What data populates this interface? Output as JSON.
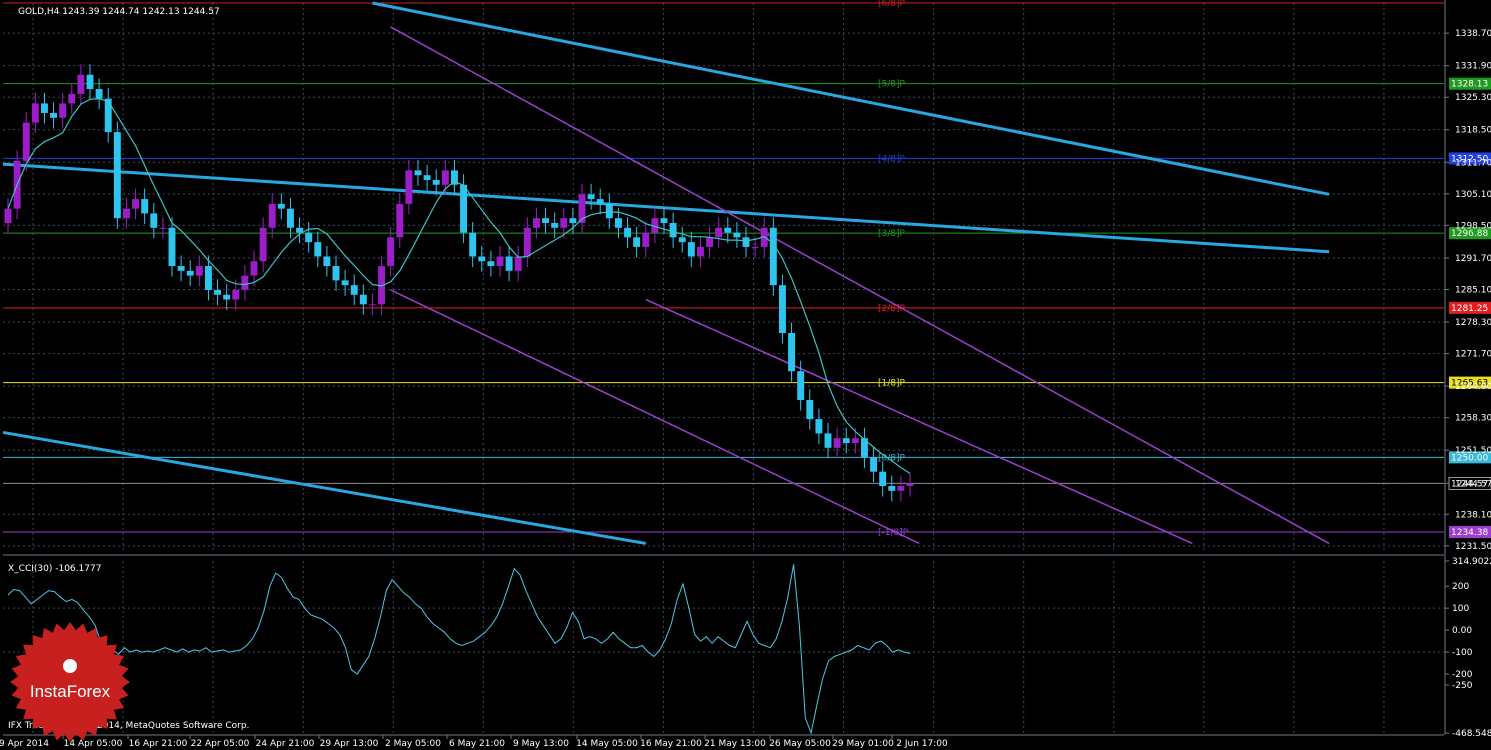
{
  "window": {
    "symbol_header": "GOLD,H4  1243.39 1244.74 1242.13 1244.57",
    "indicator_header": "X_CCI(30) -106.1777",
    "copyright": "IFX Trader, © 2001-2014, MetaQuotes Software Corp.",
    "logo_text": "InstaForex"
  },
  "colors": {
    "background": "#000000",
    "grid": "#3a4a5a",
    "bull_candle": "#9b1ec8",
    "bear_candle": "#2ec4f0",
    "moving_average": "#3cc4c4",
    "channel_blue": "#29a8e0",
    "channel_purple": "#9b3fd0",
    "cci_line": "#4fc8e8",
    "logo_red": "#c8201e"
  },
  "chart_data": [
    {
      "type": "candlestick",
      "symbol": "GOLD",
      "timeframe": "H4",
      "ohlc_last": {
        "open": 1243.39,
        "high": 1244.74,
        "low": 1242.13,
        "close": 1244.57
      },
      "y_ticks": [
        "1338.70",
        "1331.90",
        "1325.30",
        "1318.50",
        "1311.70",
        "1305.10",
        "1298.50",
        "1291.70",
        "1285.10",
        "1278.30",
        "1271.70",
        "1264.90",
        "1258.30",
        "1251.50",
        "1244.57",
        "1238.10",
        "1231.50"
      ],
      "ylim": [
        1230,
        1345
      ],
      "x_ticks": [
        "9 Apr 2014",
        "14 Apr 05:00",
        "16 Apr 21:00",
        "22 Apr 05:00",
        "24 Apr 21:00",
        "29 Apr 13:00",
        "2 May 05:00",
        "6 May 21:00",
        "9 May 13:00",
        "14 May 05:00",
        "16 May 21:00",
        "21 May 13:00",
        "26 May 05:00",
        "29 May 01:00",
        "2 Jun 17:00"
      ],
      "close_path": [
        1302,
        1312,
        1320,
        1324,
        1322,
        1321,
        1324,
        1326,
        1330,
        1327,
        1325,
        1318,
        1300,
        1302,
        1304,
        1301,
        1298,
        1298,
        1290,
        1289,
        1288,
        1290,
        1285,
        1284,
        1283,
        1285,
        1288,
        1291,
        1298,
        1303,
        1302,
        1298,
        1297,
        1295,
        1292,
        1290,
        1287,
        1286,
        1284,
        1282,
        1282,
        1290,
        1296,
        1303,
        1310,
        1309,
        1308,
        1307,
        1310,
        1307,
        1297,
        1292,
        1291,
        1290,
        1292,
        1289,
        1292,
        1298,
        1300,
        1299,
        1298,
        1300,
        1299,
        1305,
        1304,
        1303,
        1300,
        1298,
        1296,
        1294,
        1297,
        1300,
        1299,
        1296,
        1295,
        1292,
        1294,
        1296,
        1298,
        1297,
        1296,
        1294,
        1294,
        1298,
        1286,
        1276,
        1268,
        1262,
        1258,
        1255,
        1252,
        1254,
        1253,
        1254,
        1250,
        1247,
        1244,
        1243,
        1244,
        1244.57
      ],
      "levels": [
        {
          "label": "[6/8]P",
          "value": 1345.0,
          "color": "#cc2020",
          "tag": ""
        },
        {
          "label": "[5/8]P",
          "value": 1328.13,
          "color": "#1e9a1e",
          "tag": "1328.13"
        },
        {
          "label": "[4/8]P",
          "value": 1312.5,
          "color": "#2040e0",
          "tag": "1312.50"
        },
        {
          "label": "[3/8]P",
          "value": 1296.88,
          "color": "#1e9a1e",
          "tag": "1296.88"
        },
        {
          "label": "[2/8]P",
          "value": 1281.25,
          "color": "#e02020",
          "tag": "1281.25"
        },
        {
          "label": "[1/8]P",
          "value": 1265.63,
          "color": "#e8e020",
          "tag": "1265.63"
        },
        {
          "label": "[0/8]P",
          "value": 1250.0,
          "color": "#3ab8d8",
          "tag": "1250.00"
        },
        {
          "label": "[-1/8]P",
          "value": 1234.38,
          "color": "#9b3fd0",
          "tag": "1234.38"
        }
      ],
      "current_price": "1244.57"
    },
    {
      "type": "line",
      "name": "X_CCI(30)",
      "current_value": -106.1777,
      "y_ticks": [
        "314.9022",
        "200",
        "100",
        "0.00",
        "-100",
        "-200",
        "-250",
        "-468.5486"
      ],
      "ylim": [
        -468.5486,
        314.9022
      ],
      "values": [
        160,
        185,
        180,
        150,
        120,
        140,
        160,
        180,
        175,
        150,
        130,
        140,
        125,
        90,
        60,
        20,
        -60,
        -120,
        -90,
        -110,
        -80,
        -100,
        -90,
        -100,
        -95,
        -100,
        -90,
        -80,
        -90,
        -100,
        -85,
        -100,
        -90,
        -95,
        -80,
        -100,
        -95,
        -90,
        -100,
        -95,
        -90,
        -70,
        -40,
        10,
        90,
        200,
        260,
        240,
        190,
        150,
        140,
        100,
        70,
        60,
        50,
        30,
        10,
        -20,
        -80,
        -180,
        -200,
        -160,
        -120,
        -40,
        60,
        180,
        230,
        200,
        170,
        150,
        120,
        100,
        60,
        30,
        10,
        -10,
        -40,
        -60,
        -70,
        -60,
        -50,
        -30,
        -10,
        20,
        60,
        120,
        200,
        280,
        250,
        180,
        120,
        60,
        20,
        -20,
        -60,
        -40,
        10,
        80,
        40,
        -40,
        -30,
        -40,
        -60,
        -40,
        -10,
        -40,
        -60,
        -80,
        -80,
        -70,
        -100,
        -120,
        -90,
        -40,
        30,
        140,
        210,
        100,
        -20,
        -50,
        -30,
        -60,
        -30,
        -50,
        -70,
        -80,
        -20,
        40,
        -20,
        -60,
        -70,
        -80,
        -40,
        40,
        150,
        300,
        20,
        -400,
        -468,
        -340,
        -220,
        -140,
        -120,
        -110,
        -100,
        -90,
        -70,
        -80,
        -90,
        -60,
        -50,
        -70,
        -100,
        -90,
        -100,
        -106
      ]
    }
  ]
}
